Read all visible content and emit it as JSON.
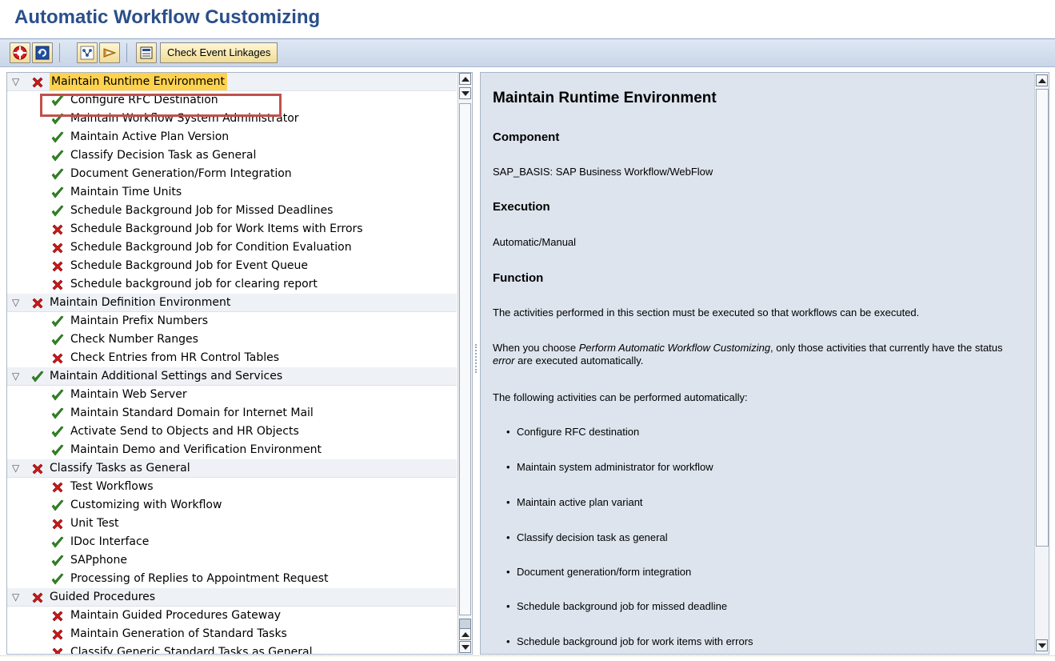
{
  "window": {
    "title": "Automatic Workflow Customizing"
  },
  "toolbar": {
    "icons": [
      "perform-automatic-customizing-icon",
      "refresh-icon",
      "hierarchy-icon",
      "expand-icon",
      "document-icon"
    ],
    "check_event_linkages_label": "Check Event Linkages"
  },
  "tree": {
    "items": [
      {
        "level": "group",
        "status": "error",
        "label": "Maintain Runtime Environment",
        "selected": true
      },
      {
        "level": "child",
        "status": "ok",
        "label": "Configure RFC Destination"
      },
      {
        "level": "child",
        "status": "ok",
        "label": "Maintain Workflow System Administrator"
      },
      {
        "level": "child",
        "status": "ok",
        "label": "Maintain Active Plan Version"
      },
      {
        "level": "child",
        "status": "ok",
        "label": "Classify Decision Task as General"
      },
      {
        "level": "child",
        "status": "ok",
        "label": "Document Generation/Form Integration"
      },
      {
        "level": "child",
        "status": "ok",
        "label": "Maintain Time Units"
      },
      {
        "level": "child",
        "status": "ok",
        "label": "Schedule Background Job for Missed Deadlines"
      },
      {
        "level": "child",
        "status": "error",
        "label": "Schedule Background Job for Work Items with Errors"
      },
      {
        "level": "child",
        "status": "error",
        "label": "Schedule Background Job for Condition Evaluation"
      },
      {
        "level": "child",
        "status": "error",
        "label": "Schedule Background Job for Event Queue"
      },
      {
        "level": "child",
        "status": "error",
        "label": "Schedule background job for clearing report"
      },
      {
        "level": "group",
        "status": "error",
        "label": "Maintain Definition Environment"
      },
      {
        "level": "child",
        "status": "ok",
        "label": "Maintain Prefix Numbers"
      },
      {
        "level": "child",
        "status": "ok",
        "label": "Check Number Ranges"
      },
      {
        "level": "child",
        "status": "error",
        "label": "Check Entries from HR Control Tables"
      },
      {
        "level": "group",
        "status": "ok",
        "label": "Maintain Additional Settings and Services"
      },
      {
        "level": "child",
        "status": "ok",
        "label": "Maintain Web Server"
      },
      {
        "level": "child",
        "status": "ok",
        "label": "Maintain Standard Domain for Internet Mail"
      },
      {
        "level": "child",
        "status": "ok",
        "label": "Activate Send to Objects and HR Objects"
      },
      {
        "level": "child",
        "status": "ok",
        "label": "Maintain Demo and Verification Environment"
      },
      {
        "level": "group",
        "status": "error",
        "label": "Classify Tasks as General"
      },
      {
        "level": "child",
        "status": "error",
        "label": "Test Workflows"
      },
      {
        "level": "child",
        "status": "ok",
        "label": "Customizing with Workflow"
      },
      {
        "level": "child",
        "status": "error",
        "label": "Unit Test"
      },
      {
        "level": "child",
        "status": "ok",
        "label": "IDoc Interface"
      },
      {
        "level": "child",
        "status": "ok",
        "label": "SAPphone"
      },
      {
        "level": "child",
        "status": "ok",
        "label": "Processing of Replies to Appointment Request"
      },
      {
        "level": "group",
        "status": "error",
        "label": "Guided Procedures"
      },
      {
        "level": "child",
        "status": "error",
        "label": "Maintain Guided Procedures Gateway"
      },
      {
        "level": "child",
        "status": "error",
        "label": "Maintain Generation of Standard Tasks"
      },
      {
        "level": "child",
        "status": "error",
        "label": "Classify Generic Standard Tasks as General"
      }
    ]
  },
  "doc": {
    "title": "Maintain Runtime Environment",
    "component_heading": "Component",
    "component_text": "SAP_BASIS: SAP Business Workflow/WebFlow",
    "execution_heading": "Execution",
    "execution_text": "Automatic/Manual",
    "function_heading": "Function",
    "function_p1": "The activities performed in this section must be executed so that workflows can be executed.",
    "function_p2_a": "When you choose ",
    "function_p2_em1": "Perform Automatic Workflow Customizing",
    "function_p2_b": ",  only those activities that currently have the status ",
    "function_p2_em2": "error",
    "function_p2_c": " are executed automatically.",
    "function_p3": "The following activities can be performed automatically:",
    "bullets": [
      "Configure RFC destination",
      "Maintain system administrator for workflow",
      "Maintain active plan variant",
      "Classify decision task as general",
      "Document generation/form integration",
      "Schedule background job for missed deadline",
      "Schedule background job for work items with errors"
    ]
  },
  "colors": {
    "title": "#2a4f8a",
    "ok": "#2e8b1e",
    "error": "#cc1a1a",
    "selected_highlight": "#ffd24d",
    "annotation_box": "#c0504d"
  }
}
